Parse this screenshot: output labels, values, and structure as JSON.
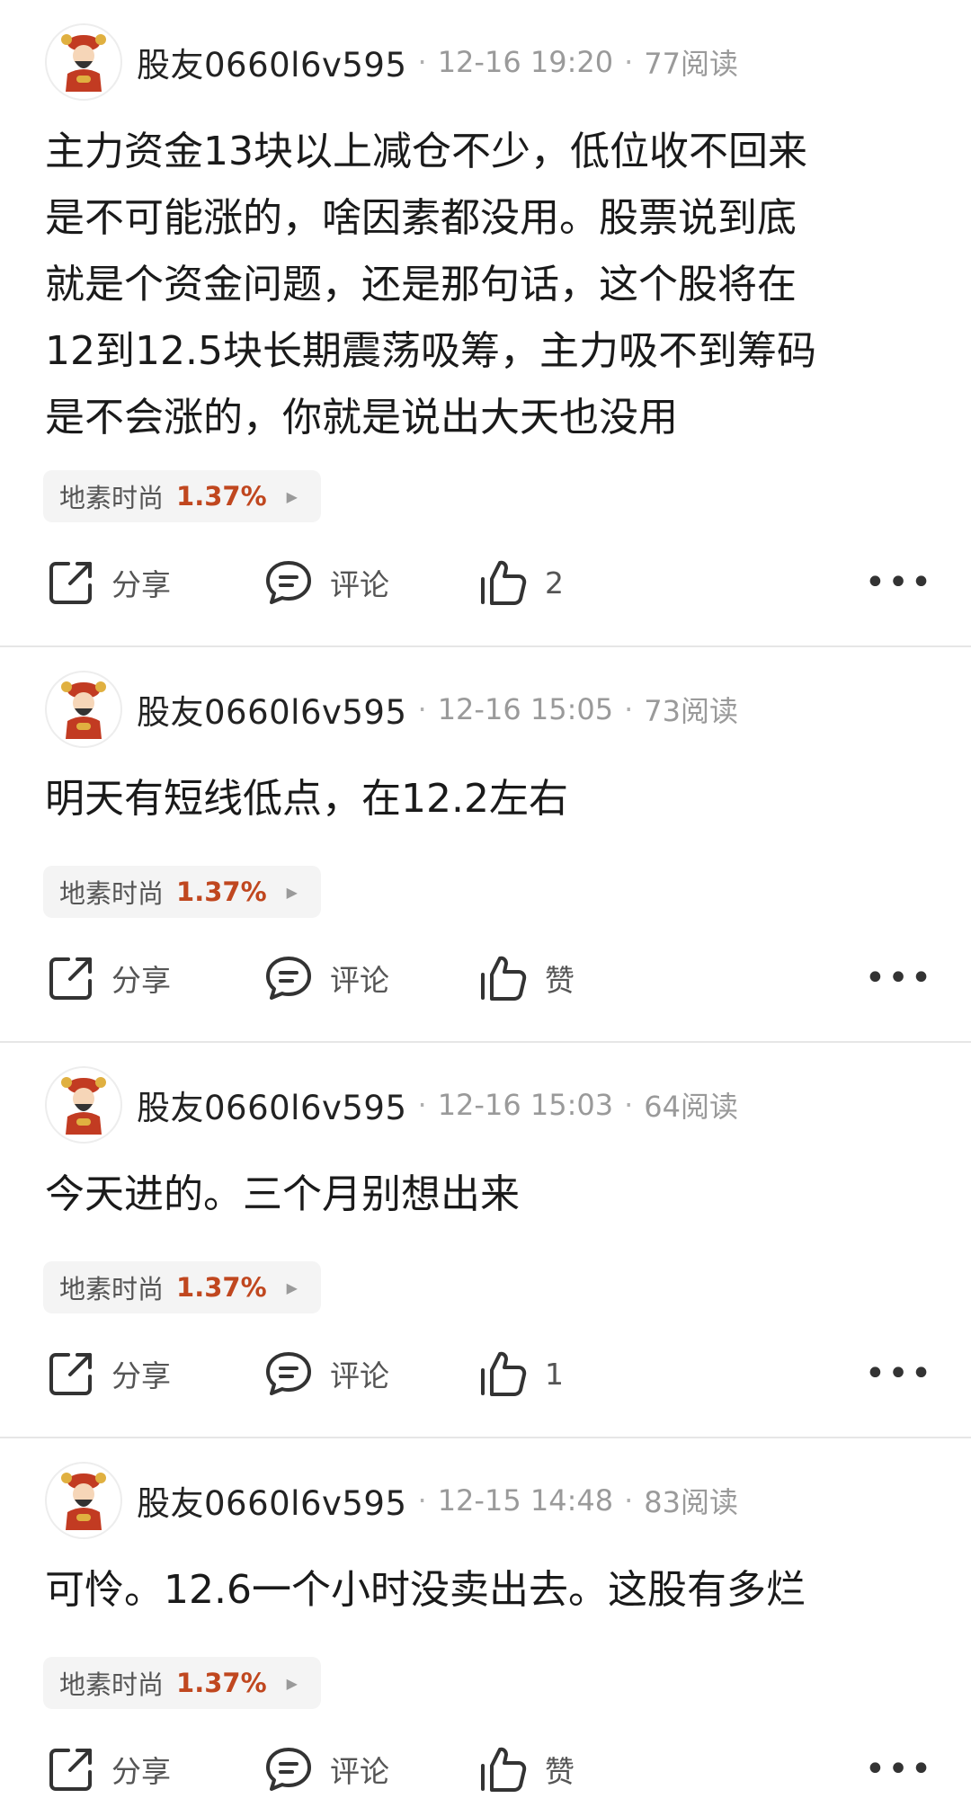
{
  "posts": [
    {
      "username": "股友0660l6v595",
      "date": "12-16 19:20",
      "reads": "77阅读",
      "content_lines": [
        "主力资金13块以上减仓不少，低位收不回来",
        "是不可能涨的，啥因素都没用。股票说到底",
        "就是个资金问题，还是那句话，这个股将在",
        "12到12.5块长期震荡吸筹，主力吸不到筹码",
        "是不会涨的，你就是说出大天也没用"
      ],
      "stock_name": "地素时尚",
      "stock_change": "1.37%",
      "share_label": "分享",
      "comment_label": "评论",
      "like_label": "2"
    },
    {
      "username": "股友0660l6v595",
      "date": "12-16 15:05",
      "reads": "73阅读",
      "content_lines": [
        "明天有短线低点，在12.2左右"
      ],
      "stock_name": "地素时尚",
      "stock_change": "1.37%",
      "share_label": "分享",
      "comment_label": "评论",
      "like_label": "赞"
    },
    {
      "username": "股友0660l6v595",
      "date": "12-16 15:03",
      "reads": "64阅读",
      "content_lines": [
        "今天进的。三个月别想出来"
      ],
      "stock_name": "地素时尚",
      "stock_change": "1.37%",
      "share_label": "分享",
      "comment_label": "评论",
      "like_label": "1"
    },
    {
      "username": "股友0660l6v595",
      "date": "12-15 14:48",
      "reads": "83阅读",
      "content_lines": [
        "可怜。12.6一个小时没卖出去。这股有多烂"
      ],
      "stock_name": "地素时尚",
      "stock_change": "1.37%",
      "share_label": "分享",
      "comment_label": "评论",
      "like_label": "赞"
    }
  ],
  "meta_separator": "·",
  "more_label": "•••",
  "tag_arrow": "▶",
  "icons": {
    "avatar": "caishen-avatar-icon",
    "share": "share-icon",
    "comment": "comment-icon",
    "like": "thumbs-up-icon",
    "more": "more-icon"
  },
  "colors": {
    "stock_change": "#c0471f",
    "meta_text": "#9a9a9a",
    "tag_background": "#f4f4f4"
  }
}
